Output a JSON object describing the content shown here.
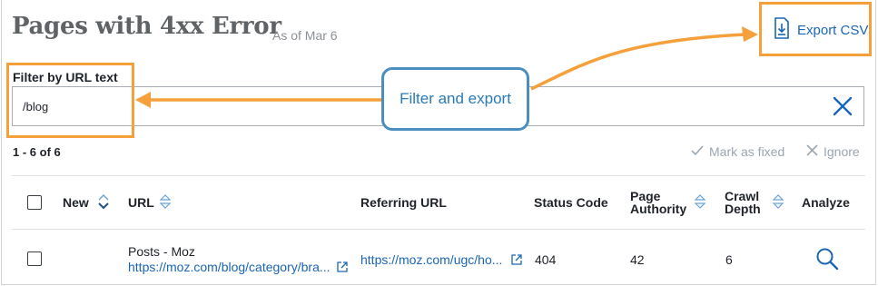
{
  "header": {
    "title": "Pages with 4xx Error",
    "as_of": "As of Mar 6"
  },
  "export": {
    "label": "Export CSV",
    "icon": "export-file-icon"
  },
  "filter": {
    "label": "Filter by URL text",
    "value": "/blog",
    "clear_icon": "close-icon"
  },
  "annotation": {
    "text": "Filter and export"
  },
  "results": {
    "count": "1 - 6 of 6",
    "mark_fixed": "Mark as fixed",
    "ignore": "Ignore"
  },
  "table": {
    "columns": {
      "new": "New",
      "url": "URL",
      "referring_url": "Referring URL",
      "status_code": "Status Code",
      "page_authority_1": "Page",
      "page_authority_2": "Authority",
      "crawl_depth_1": "Crawl",
      "crawl_depth_2": "Depth",
      "analyze": "Analyze"
    },
    "rows": [
      {
        "page_title": "Posts - Moz",
        "url": "https://moz.com/blog/category/bra...",
        "referring_url": "https://moz.com/ugc/ho...",
        "status_code": "404",
        "page_authority": "42",
        "crawl_depth": "6"
      }
    ]
  },
  "colors": {
    "accent_orange": "#f5a03a",
    "annotation_blue": "#4a8fbf",
    "link_blue": "#1a66b5",
    "muted": "#9aa6b2"
  }
}
